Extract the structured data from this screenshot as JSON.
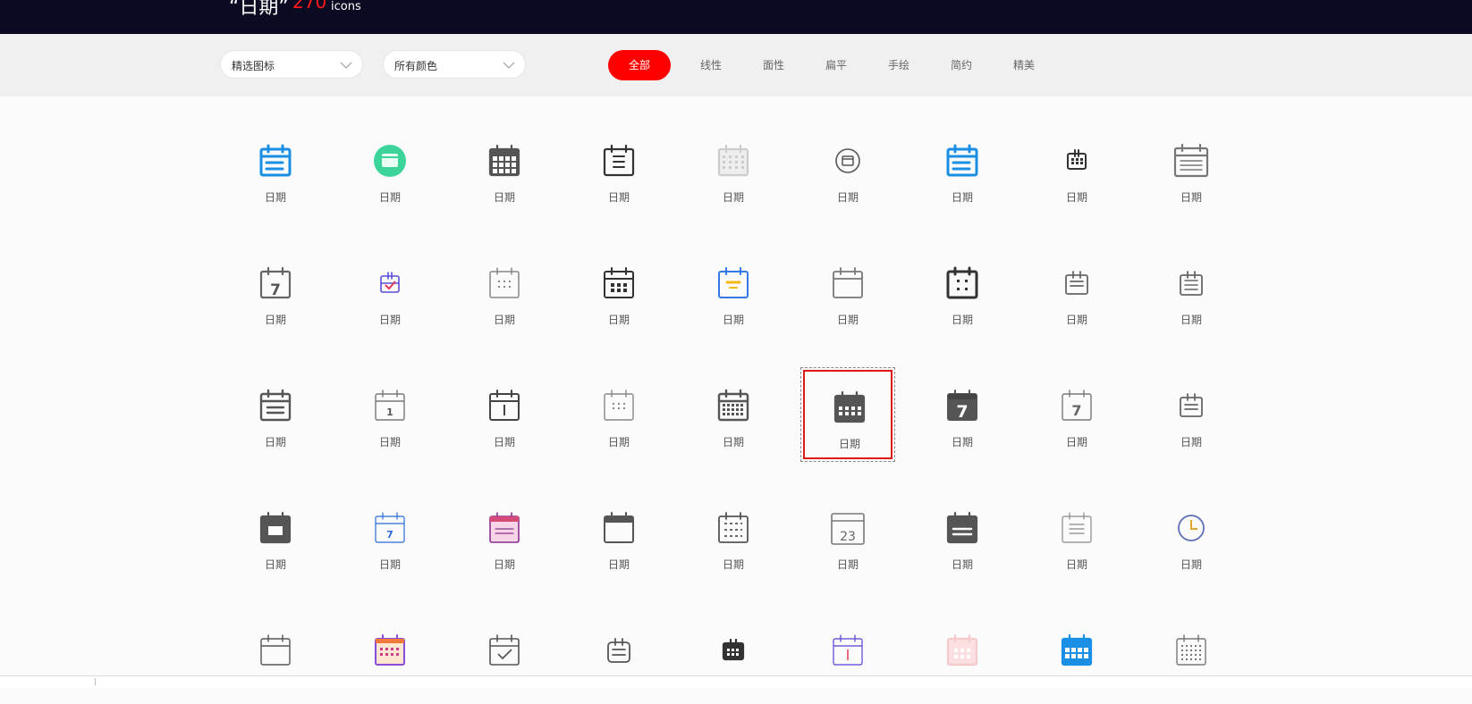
{
  "header": {
    "title": "“日期”",
    "count": "270",
    "unit": "icons"
  },
  "filters": {
    "select_icons": "精选图标",
    "select_colors": "所有颜色",
    "tabs": [
      "全部",
      "线性",
      "面性",
      "扁平",
      "手绘",
      "简约",
      "精美"
    ]
  },
  "icons": {
    "label": "日期",
    "rows": [
      [
        "calendar-blue-lines",
        "calendar-green-circle",
        "calendar-grid-dark",
        "calendar-lines-outline",
        "calendar-light-grey",
        "calendar-circle",
        "calendar-blue-lines",
        "calendar-small-dark",
        "calendar-wide-grid"
      ],
      [
        "calendar-seven",
        "calendar-check-purple",
        "calendar-dots",
        "calendar-dots-dark",
        "calendar-blue-yellow",
        "calendar-plain",
        "calendar-bold-dots",
        "calendar-lines-small",
        "calendar-lines-small-2"
      ],
      [
        "calendar-list",
        "calendar-one",
        "calendar-bar",
        "calendar-dots-light",
        "calendar-grid-full",
        "calendar-grid-filled",
        "calendar-seven-filled",
        "calendar-seven-outline",
        "calendar-list-small"
      ],
      [
        "calendar-filled-square",
        "calendar-seven-blue",
        "calendar-pink-purple",
        "calendar-plain-dark",
        "calendar-dashed",
        "calendar-23",
        "calendar-filled-list",
        "calendar-lines-thin",
        "calendar-clock"
      ],
      [
        "calendar-plain-thin",
        "calendar-orange-purple",
        "calendar-check-box",
        "calendar-lines-rounded",
        "calendar-dark-small",
        "calendar-purple-bar",
        "calendar-pink-light",
        "calendar-blue-grid",
        "calendar-dotted-grid"
      ]
    ]
  },
  "colors": {
    "accent": "#ff0000",
    "header_bg": "#0a0a22"
  }
}
